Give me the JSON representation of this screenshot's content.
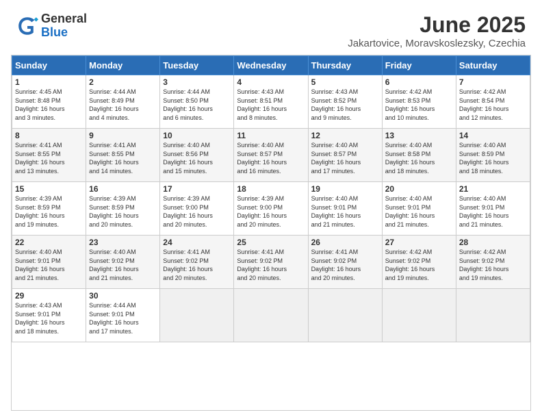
{
  "logo": {
    "general": "General",
    "blue": "Blue"
  },
  "title": "June 2025",
  "subtitle": "Jakartovice, Moravskoslezsky, Czechia",
  "days_header": [
    "Sunday",
    "Monday",
    "Tuesday",
    "Wednesday",
    "Thursday",
    "Friday",
    "Saturday"
  ],
  "weeks": [
    [
      {
        "day": "1",
        "info": "Sunrise: 4:45 AM\nSunset: 8:48 PM\nDaylight: 16 hours\nand 3 minutes."
      },
      {
        "day": "2",
        "info": "Sunrise: 4:44 AM\nSunset: 8:49 PM\nDaylight: 16 hours\nand 4 minutes."
      },
      {
        "day": "3",
        "info": "Sunrise: 4:44 AM\nSunset: 8:50 PM\nDaylight: 16 hours\nand 6 minutes."
      },
      {
        "day": "4",
        "info": "Sunrise: 4:43 AM\nSunset: 8:51 PM\nDaylight: 16 hours\nand 8 minutes."
      },
      {
        "day": "5",
        "info": "Sunrise: 4:43 AM\nSunset: 8:52 PM\nDaylight: 16 hours\nand 9 minutes."
      },
      {
        "day": "6",
        "info": "Sunrise: 4:42 AM\nSunset: 8:53 PM\nDaylight: 16 hours\nand 10 minutes."
      },
      {
        "day": "7",
        "info": "Sunrise: 4:42 AM\nSunset: 8:54 PM\nDaylight: 16 hours\nand 12 minutes."
      }
    ],
    [
      {
        "day": "8",
        "info": "Sunrise: 4:41 AM\nSunset: 8:55 PM\nDaylight: 16 hours\nand 13 minutes."
      },
      {
        "day": "9",
        "info": "Sunrise: 4:41 AM\nSunset: 8:55 PM\nDaylight: 16 hours\nand 14 minutes."
      },
      {
        "day": "10",
        "info": "Sunrise: 4:40 AM\nSunset: 8:56 PM\nDaylight: 16 hours\nand 15 minutes."
      },
      {
        "day": "11",
        "info": "Sunrise: 4:40 AM\nSunset: 8:57 PM\nDaylight: 16 hours\nand 16 minutes."
      },
      {
        "day": "12",
        "info": "Sunrise: 4:40 AM\nSunset: 8:57 PM\nDaylight: 16 hours\nand 17 minutes."
      },
      {
        "day": "13",
        "info": "Sunrise: 4:40 AM\nSunset: 8:58 PM\nDaylight: 16 hours\nand 18 minutes."
      },
      {
        "day": "14",
        "info": "Sunrise: 4:40 AM\nSunset: 8:59 PM\nDaylight: 16 hours\nand 18 minutes."
      }
    ],
    [
      {
        "day": "15",
        "info": "Sunrise: 4:39 AM\nSunset: 8:59 PM\nDaylight: 16 hours\nand 19 minutes."
      },
      {
        "day": "16",
        "info": "Sunrise: 4:39 AM\nSunset: 8:59 PM\nDaylight: 16 hours\nand 20 minutes."
      },
      {
        "day": "17",
        "info": "Sunrise: 4:39 AM\nSunset: 9:00 PM\nDaylight: 16 hours\nand 20 minutes."
      },
      {
        "day": "18",
        "info": "Sunrise: 4:39 AM\nSunset: 9:00 PM\nDaylight: 16 hours\nand 20 minutes."
      },
      {
        "day": "19",
        "info": "Sunrise: 4:40 AM\nSunset: 9:01 PM\nDaylight: 16 hours\nand 21 minutes."
      },
      {
        "day": "20",
        "info": "Sunrise: 4:40 AM\nSunset: 9:01 PM\nDaylight: 16 hours\nand 21 minutes."
      },
      {
        "day": "21",
        "info": "Sunrise: 4:40 AM\nSunset: 9:01 PM\nDaylight: 16 hours\nand 21 minutes."
      }
    ],
    [
      {
        "day": "22",
        "info": "Sunrise: 4:40 AM\nSunset: 9:01 PM\nDaylight: 16 hours\nand 21 minutes."
      },
      {
        "day": "23",
        "info": "Sunrise: 4:40 AM\nSunset: 9:02 PM\nDaylight: 16 hours\nand 21 minutes."
      },
      {
        "day": "24",
        "info": "Sunrise: 4:41 AM\nSunset: 9:02 PM\nDaylight: 16 hours\nand 20 minutes."
      },
      {
        "day": "25",
        "info": "Sunrise: 4:41 AM\nSunset: 9:02 PM\nDaylight: 16 hours\nand 20 minutes."
      },
      {
        "day": "26",
        "info": "Sunrise: 4:41 AM\nSunset: 9:02 PM\nDaylight: 16 hours\nand 20 minutes."
      },
      {
        "day": "27",
        "info": "Sunrise: 4:42 AM\nSunset: 9:02 PM\nDaylight: 16 hours\nand 19 minutes."
      },
      {
        "day": "28",
        "info": "Sunrise: 4:42 AM\nSunset: 9:02 PM\nDaylight: 16 hours\nand 19 minutes."
      }
    ],
    [
      {
        "day": "29",
        "info": "Sunrise: 4:43 AM\nSunset: 9:01 PM\nDaylight: 16 hours\nand 18 minutes."
      },
      {
        "day": "30",
        "info": "Sunrise: 4:44 AM\nSunset: 9:01 PM\nDaylight: 16 hours\nand 17 minutes."
      },
      {
        "day": "",
        "info": ""
      },
      {
        "day": "",
        "info": ""
      },
      {
        "day": "",
        "info": ""
      },
      {
        "day": "",
        "info": ""
      },
      {
        "day": "",
        "info": ""
      }
    ]
  ]
}
